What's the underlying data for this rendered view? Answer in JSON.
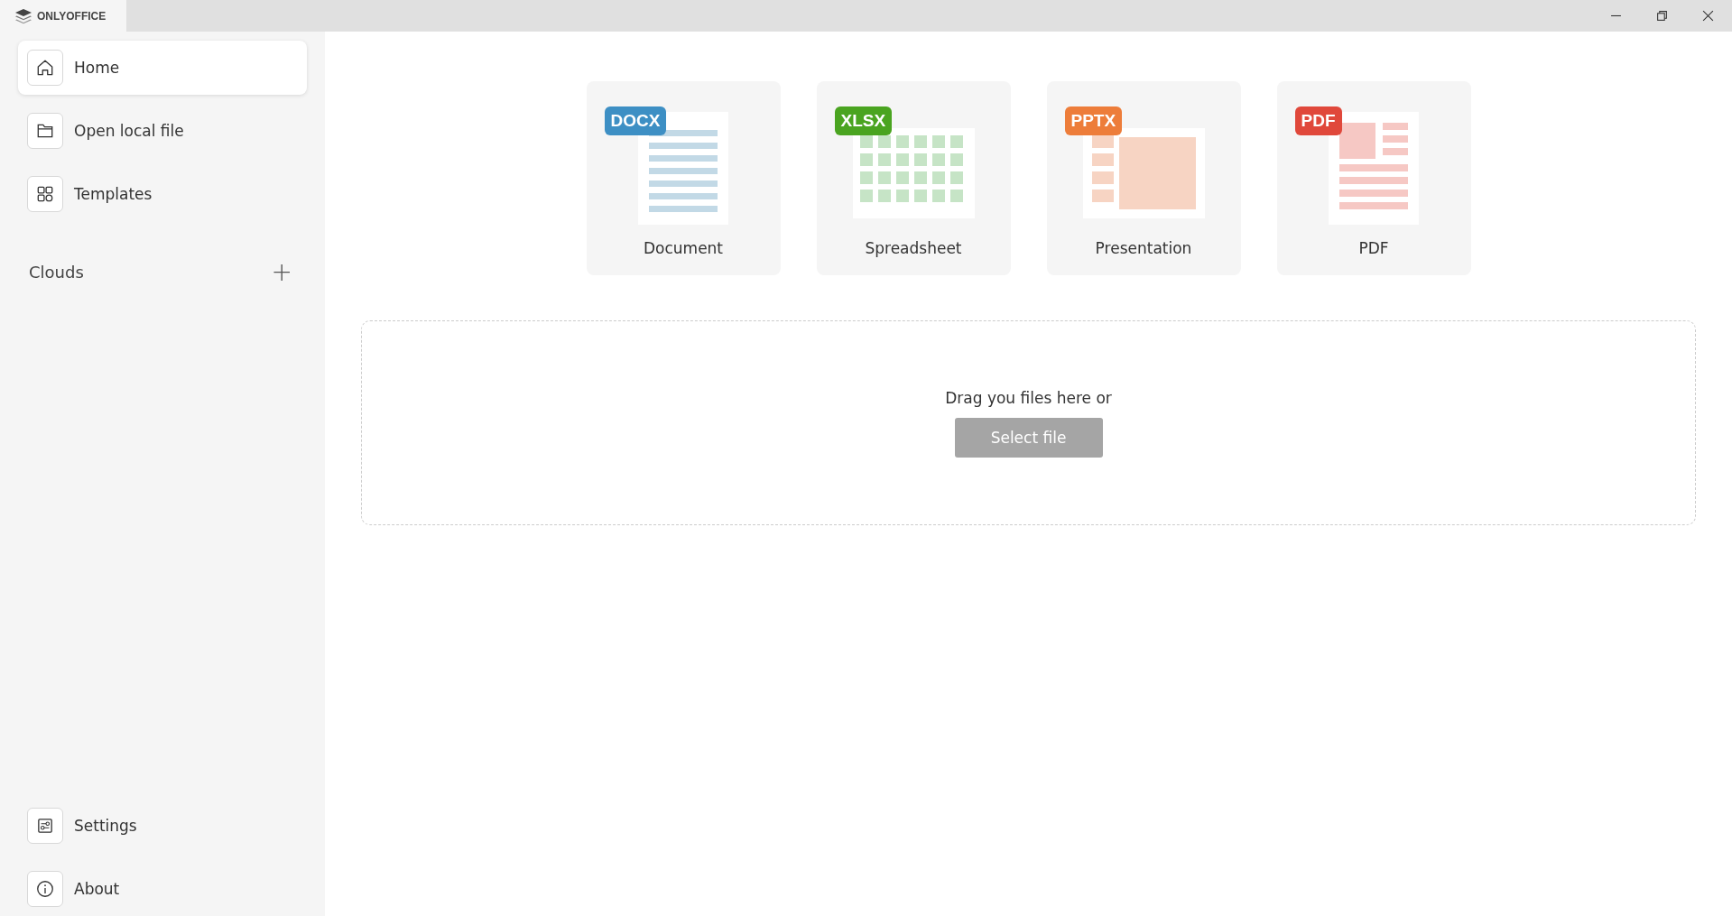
{
  "window": {
    "title": "ONLYOFFICE"
  },
  "sidebar": {
    "items": [
      {
        "kind": "home",
        "label": "Home",
        "selected": true
      },
      {
        "kind": "folder",
        "label": "Open local file",
        "selected": false
      },
      {
        "kind": "grid",
        "label": "Templates",
        "selected": false
      }
    ],
    "clouds": {
      "label": "Clouds",
      "add": "+"
    },
    "bottom_items": [
      {
        "kind": "settings",
        "label": "Settings",
        "selected": false
      },
      {
        "kind": "info",
        "label": "About",
        "selected": false
      }
    ]
  },
  "new_files": [
    {
      "kind": "document",
      "badge": "DOCX",
      "label": "Document",
      "color": "#3d8fc4"
    },
    {
      "kind": "spreadsheet",
      "badge": "XLSX",
      "label": "Spreadsheet",
      "color": "#4aa420"
    },
    {
      "kind": "presentation",
      "badge": "PPTX",
      "label": "Presentation",
      "color": "#ed7d3a"
    },
    {
      "kind": "pdf",
      "badge": "PDF",
      "label": "PDF",
      "color": "#e0483b"
    }
  ],
  "drop_zone": {
    "text": "Drag you files here or",
    "button": "Select file"
  }
}
